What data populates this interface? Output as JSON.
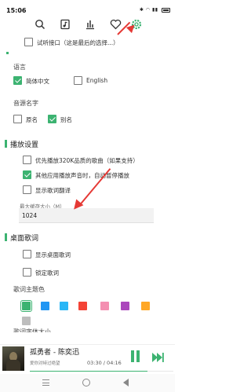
{
  "status": {
    "time": "15:06",
    "icons_text": "✱ 📶 ▮▮▮ 🔋"
  },
  "toolbar": {
    "icons": [
      "search-icon",
      "music-file-icon",
      "bar-chart-icon",
      "heart-icon",
      "settings-icon"
    ]
  },
  "top_partial_option": {
    "label": "试听接口（这是最后的选择...）"
  },
  "language": {
    "title": "语言",
    "options": [
      {
        "label": "简体中文",
        "checked": true
      },
      {
        "label": "English",
        "checked": false
      }
    ]
  },
  "source_name": {
    "title": "音源名字",
    "options": [
      {
        "label": "原名",
        "checked": false
      },
      {
        "label": "别名",
        "checked": true
      }
    ]
  },
  "playback": {
    "title": "播放设置",
    "options": [
      {
        "label": "优先播放320K品质的歌曲（如果支持）",
        "checked": false
      },
      {
        "label": "其他应用播放声音时，自动暂停播放",
        "checked": true
      },
      {
        "label": "显示歌词翻译",
        "checked": false
      }
    ],
    "cache_label": "最大缓存大小（M）",
    "cache_value": "1024"
  },
  "desktop_lyrics": {
    "title": "桌面歌词",
    "options": [
      {
        "label": "显示桌面歌词",
        "checked": false
      },
      {
        "label": "锁定歌词",
        "checked": false
      }
    ],
    "theme_title": "歌词主题色",
    "theme_colors": [
      "#3cb371",
      "#2196f3",
      "#29b6f6",
      "#f44336",
      "#f48fb1",
      "#ab47bc",
      "#ffa726",
      "#bdbdbd"
    ],
    "font_size_title": "歌词字体大小"
  },
  "player": {
    "title": "孤勇者 - 陈奕迅",
    "subtitle": "爱你对峙过绝望",
    "time": "03:30 / 04:16",
    "accent": "#3cb371"
  }
}
